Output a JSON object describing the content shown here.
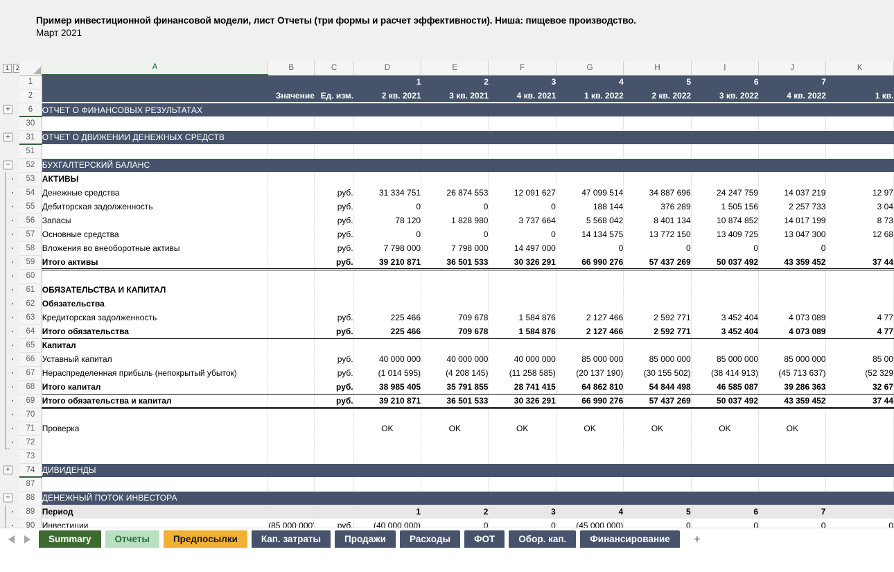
{
  "title": {
    "main": "Пример инвестиционной финансовой модели, лист Отчеты (три формы и расчет эффективности). Ниша: пищевое производство.",
    "sub": "Март 2021"
  },
  "outline": {
    "level1": "1",
    "level2": "2"
  },
  "columns": {
    "letters": [
      "A",
      "B",
      "C",
      "D",
      "E",
      "F",
      "G",
      "H",
      "I",
      "J",
      "K"
    ]
  },
  "header": {
    "value_label": "Значение",
    "unit_label": "Ед. изм.",
    "period_numbers": [
      "1",
      "2",
      "3",
      "4",
      "5",
      "6",
      "7",
      ""
    ],
    "period_names": [
      "2 кв. 2021",
      "3 кв. 2021",
      "4 кв. 2021",
      "1 кв. 2022",
      "2 кв. 2022",
      "3 кв. 2022",
      "4 кв. 2022",
      "1 кв."
    ]
  },
  "unit": "руб.",
  "rows": [
    {
      "n": "6",
      "kind": "banner",
      "label": "ОТЧЕТ О ФИНАНСОВЫХ РЕЗУЛЬТАТАХ",
      "gutter": "plus",
      "greenline": true
    },
    {
      "n": "30",
      "kind": "blank"
    },
    {
      "n": "31",
      "kind": "banner",
      "label": "ОТЧЕТ О ДВИЖЕНИИ ДЕНЕЖНЫХ СРЕДСТВ",
      "gutter": "plus",
      "greenline": true
    },
    {
      "n": "51",
      "kind": "blank"
    },
    {
      "n": "52",
      "kind": "banner",
      "label": "БУХГАЛТЕРСКИЙ БАЛАНС",
      "gutter": "minus"
    },
    {
      "n": "53",
      "kind": "head",
      "label": "АКТИВЫ",
      "gutter": "dot"
    },
    {
      "n": "54",
      "kind": "data",
      "label": "Денежные средства",
      "unit": "руб.",
      "gutter": "dot",
      "values": [
        "31 334 751",
        "26 874 553",
        "12 091 627",
        "47 099 514",
        "34 887 696",
        "24 247 759",
        "14 037 219",
        "12 97"
      ]
    },
    {
      "n": "55",
      "kind": "data",
      "label": "Дебиторская задолженность",
      "unit": "руб.",
      "gutter": "dot",
      "values": [
        "0",
        "0",
        "0",
        "188 144",
        "376 289",
        "1 505 156",
        "2 257 733",
        "3 04"
      ]
    },
    {
      "n": "56",
      "kind": "data",
      "label": "Запасы",
      "unit": "руб.",
      "gutter": "dot",
      "values": [
        "78 120",
        "1 828 980",
        "3 737 664",
        "5 568 042",
        "8 401 134",
        "10 874 852",
        "14 017 199",
        "8 73"
      ]
    },
    {
      "n": "57",
      "kind": "data",
      "label": "Основные средства",
      "unit": "руб.",
      "gutter": "dot",
      "values": [
        "0",
        "0",
        "0",
        "14 134 575",
        "13 772 150",
        "13 409 725",
        "13 047 300",
        "12 68"
      ]
    },
    {
      "n": "58",
      "kind": "data",
      "label": "Вложения во внеоборотные активы",
      "unit": "руб.",
      "gutter": "dot",
      "values": [
        "7 798 000",
        "7 798 000",
        "14 497 000",
        "0",
        "0",
        "0",
        "0",
        ""
      ]
    },
    {
      "n": "59",
      "kind": "total",
      "label": "Итого активы",
      "unit": "руб.",
      "gutter": "dot",
      "rule": "double",
      "values": [
        "39 210 871",
        "36 501 533",
        "30 326 291",
        "66 990 276",
        "57 437 269",
        "50 037 492",
        "43 359 452",
        "37 44"
      ]
    },
    {
      "n": "60",
      "kind": "blank",
      "gutter": "dot"
    },
    {
      "n": "61",
      "kind": "head",
      "label": "ОБЯЗАТЕЛЬСТВА И КАПИТАЛ",
      "gutter": "dot"
    },
    {
      "n": "62",
      "kind": "head",
      "label": "Обязательства",
      "gutter": "dot"
    },
    {
      "n": "63",
      "kind": "data",
      "label": "Кредиторская задолженность",
      "unit": "руб.",
      "gutter": "dot",
      "values": [
        "225 466",
        "709 678",
        "1 584 876",
        "2 127 466",
        "2 592 771",
        "3 452 404",
        "4 073 089",
        "4 77"
      ]
    },
    {
      "n": "64",
      "kind": "total",
      "label": "Итого обязательства",
      "unit": "руб.",
      "gutter": "dot",
      "rule": "top",
      "values": [
        "225 466",
        "709 678",
        "1 584 876",
        "2 127 466",
        "2 592 771",
        "3 452 404",
        "4 073 089",
        "4 77"
      ]
    },
    {
      "n": "65",
      "kind": "head",
      "label": "Капитал",
      "gutter": "dot"
    },
    {
      "n": "66",
      "kind": "data",
      "label": "Уставный капитал",
      "unit": "руб.",
      "gutter": "dot",
      "values": [
        "40 000 000",
        "40 000 000",
        "40 000 000",
        "85 000 000",
        "85 000 000",
        "85 000 000",
        "85 000 000",
        "85 00"
      ]
    },
    {
      "n": "67",
      "kind": "data",
      "label": "Нераспределенная прибыль (непокрытый убыток)",
      "unit": "руб.",
      "gutter": "dot",
      "values": [
        "(1 014 595)",
        "(4 208 145)",
        "(11 258 585)",
        "(20 137 190)",
        "(30 155 502)",
        "(38 414 913)",
        "(45 713 637)",
        "(52 329"
      ]
    },
    {
      "n": "68",
      "kind": "total",
      "label": "Итого капитал",
      "unit": "руб.",
      "gutter": "dot",
      "rule": "top",
      "values": [
        "38 985 405",
        "35 791 855",
        "28 741 415",
        "64 862 810",
        "54 844 498",
        "46 585 087",
        "39 286 363",
        "32 67"
      ]
    },
    {
      "n": "69",
      "kind": "total",
      "label": "Итого обязательства и капитал",
      "unit": "руб.",
      "gutter": "dot",
      "rule": "double",
      "values": [
        "39 210 871",
        "36 501 533",
        "30 326 291",
        "66 990 276",
        "57 437 269",
        "50 037 492",
        "43 359 452",
        "37 44"
      ]
    },
    {
      "n": "70",
      "kind": "blank",
      "gutter": "dot"
    },
    {
      "n": "71",
      "kind": "check",
      "label": "Проверка",
      "gutter": "dot",
      "values": [
        "OK",
        "OK",
        "OK",
        "OK",
        "OK",
        "OK",
        "OK",
        ""
      ]
    },
    {
      "n": "72",
      "kind": "blank",
      "gutter": "dotend"
    },
    {
      "n": "73",
      "kind": "blank"
    },
    {
      "n": "74",
      "kind": "banner",
      "label": "ДИВИДЕНДЫ",
      "gutter": "plus",
      "greenline": true
    },
    {
      "n": "87",
      "kind": "blank"
    },
    {
      "n": "88",
      "kind": "banner",
      "label": "ДЕНЕЖНЫЙ ПОТОК ИНВЕСТОРА",
      "gutter": "minus"
    },
    {
      "n": "89",
      "kind": "band",
      "label": "Период",
      "gutter": "dot",
      "values": [
        "1",
        "2",
        "3",
        "4",
        "5",
        "6",
        "7",
        ""
      ]
    },
    {
      "n": "90",
      "kind": "data",
      "label": "Инвестиции",
      "valueB": "(85 000 000)",
      "unit": "руб.",
      "gutter": "dot",
      "values": [
        "(40 000 000)",
        "0",
        "0",
        "(45 000 000)",
        "0",
        "0",
        "0",
        "0"
      ]
    }
  ],
  "tabs": [
    {
      "label": "Summary",
      "style": "green"
    },
    {
      "label": "Отчеты",
      "style": "mint"
    },
    {
      "label": "Предпосылки",
      "style": "amber"
    },
    {
      "label": "Кап. затраты",
      "style": "dark"
    },
    {
      "label": "Продажи",
      "style": "dark"
    },
    {
      "label": "Расходы",
      "style": "dark"
    },
    {
      "label": "ФОТ",
      "style": "dark"
    },
    {
      "label": "Обор. кап.",
      "style": "dark"
    },
    {
      "label": "Финансирование",
      "style": "dark"
    }
  ],
  "add_tab": "+",
  "colors": {
    "banner": "#46536b",
    "accent_green": "#37603f",
    "tab_active": "#3d6b2f",
    "tab_amber": "#f2b134"
  }
}
